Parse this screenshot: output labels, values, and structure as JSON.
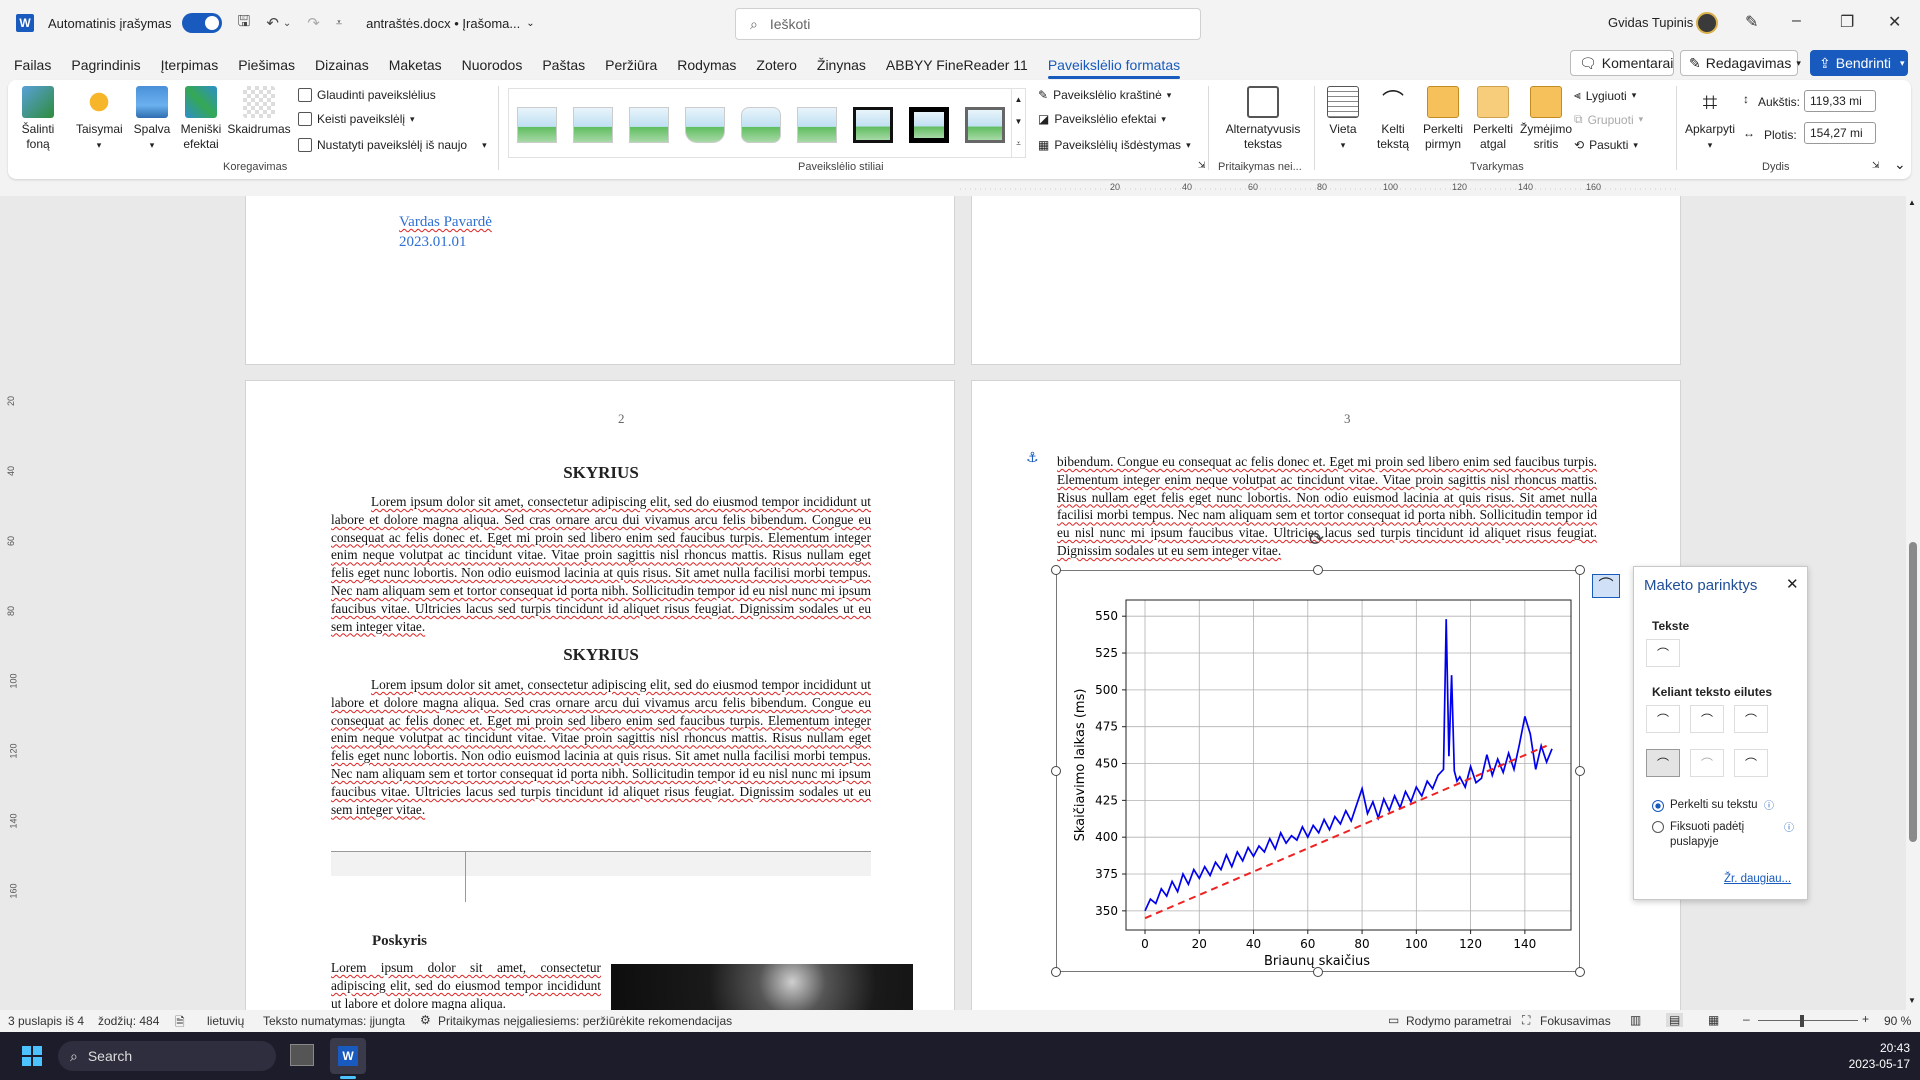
{
  "titlebar": {
    "autosave_label": "Automatinis įrašymas",
    "doc_name": "antraštės.docx • Įrašoma...",
    "search_placeholder": "Ieškoti",
    "user_name": "Gvidas Tupinis"
  },
  "menu": {
    "tabs": [
      "Failas",
      "Pagrindinis",
      "Įterpimas",
      "Piešimas",
      "Dizainas",
      "Maketas",
      "Nuorodos",
      "Paštas",
      "Peržiūra",
      "Rodymas",
      "Zotero",
      "Žinynas",
      "ABBYY FineReader 11",
      "Paveikslėlio formatas"
    ],
    "active_tab": "Paveikslėlio formatas",
    "comments": "Komentarai",
    "editing": "Redagavimas",
    "share": "Bendrinti"
  },
  "ribbon": {
    "remove_bg": "Šalinti foną",
    "corrections": "Taisymai",
    "color": "Spalva",
    "artistic": "Meniški efektai",
    "transparency": "Skaidrumas",
    "compress": "Glaudinti paveikslėlius",
    "change": "Keisti paveikslėlį",
    "reset": "Nustatyti paveikslėlį iš naujo",
    "group_adjust": "Koregavimas",
    "group_styles": "Paveikslėlio stiliai",
    "border": "Paveikslėlio kraštinė",
    "effects": "Paveikslėlio efektai",
    "layout": "Paveikslėlių išdėstymas",
    "alt_text": "Alternatyvusis tekstas",
    "group_access": "Pritaikymas nei...",
    "position": "Vieta",
    "wrap": "Kelti tekstą",
    "forward": "Perkelti pirmyn",
    "backward": "Perkelti atgal",
    "selection": "Žymėjimo sritis",
    "align": "Lygiuoti",
    "group_btn": "Grupuoti",
    "rotate": "Pasukti",
    "group_arrange": "Tvarkymas",
    "crop": "Apkarpyti",
    "height_label": "Aukštis:",
    "height_val": "119,33 mi",
    "width_label": "Plotis:",
    "width_val": "154,27 mi",
    "group_size": "Dydis"
  },
  "ruler_ticks": [
    "20",
    "40",
    "60",
    "80",
    "100",
    "120",
    "140",
    "160"
  ],
  "vruler_ticks": [
    "20",
    "40",
    "60",
    "80",
    "100",
    "120",
    "140",
    "160"
  ],
  "page1": {
    "author": "Vardas Pavardė",
    "date": "2023.01.01"
  },
  "page2": {
    "number": "2",
    "heading1": "SKYRIUS",
    "para1": "Lorem ipsum dolor sit amet, consectetur adipiscing elit, sed do eiusmod tempor incididunt ut labore et dolore magna aliqua. Sed cras ornare arcu dui vivamus arcu felis bibendum. Congue eu consequat ac felis donec et. Eget mi proin sed libero enim sed faucibus turpis. Elementum integer enim neque volutpat ac tincidunt vitae. Vitae proin sagittis nisl rhoncus mattis. Risus nullam eget felis eget nunc lobortis. Non odio euismod lacinia at quis risus. Sit amet nulla facilisi morbi tempus. Nec nam aliquam sem et tortor consequat id porta nibh. Sollicitudin tempor id eu nisl nunc mi ipsum faucibus vitae. Ultricies lacus sed turpis tincidunt id aliquet risus feugiat. Dignissim sodales ut eu sem integer vitae.",
    "heading2": "SKYRIUS",
    "para2": "Lorem ipsum dolor sit amet, consectetur adipiscing elit, sed do eiusmod tempor incididunt ut labore et dolore magna aliqua. Sed cras ornare arcu dui vivamus arcu felis bibendum. Congue eu consequat ac felis donec et. Eget mi proin sed libero enim sed faucibus turpis. Elementum integer enim neque volutpat ac tincidunt vitae. Vitae proin sagittis nisl rhoncus mattis. Risus nullam eget felis eget nunc lobortis. Non odio euismod lacinia at quis risus. Sit amet nulla facilisi morbi tempus. Nec nam aliquam sem et tortor consequat id porta nibh. Sollicitudin tempor id eu nisl nunc mi ipsum faucibus vitae. Ultricies lacus sed turpis tincidunt id aliquet risus feugiat. Dignissim sodales ut eu sem integer vitae.",
    "subheading": "Poskyris",
    "para3": "Lorem ipsum dolor sit amet, consectetur adipiscing elit, sed do eiusmod tempor incididunt ut labore et dolore magna aliqua."
  },
  "page3": {
    "number": "3",
    "para1": "bibendum. Congue eu consequat ac felis donec et. Eget mi proin sed libero enim sed faucibus turpis. Elementum integer enim neque volutpat ac tincidunt vitae. Vitae proin sagittis nisl rhoncus mattis. Risus nullam eget felis eget nunc lobortis. Non odio euismod lacinia at quis risus. Sit amet nulla facilisi morbi tempus. Nec nam aliquam sem et tortor consequat id porta nibh. Sollicitudin tempor id eu nisl nunc mi ipsum faucibus vitae. Ultricies lacus sed turpis tincidunt id aliquet risus feugiat. Dignissim sodales ut eu sem integer vitae."
  },
  "layout_pane": {
    "title": "Maketo parinktys",
    "inline_section": "Tekste",
    "wrap_section": "Keliant teksto eilutes",
    "move_with_text": "Perkelti su tekstu",
    "fix_position": "Fiksuoti padėtį puslapyje",
    "see_more": "Žr. daugiau..."
  },
  "chart_data": {
    "type": "line",
    "xlabel": "Briaunų skaičius",
    "ylabel": "Skaičiavimo laikas (ms)",
    "xlim": [
      -7,
      157
    ],
    "ylim": [
      337,
      561
    ],
    "xticks": [
      0,
      20,
      40,
      60,
      80,
      100,
      120,
      140
    ],
    "yticks": [
      350,
      375,
      400,
      425,
      450,
      475,
      500,
      525,
      550
    ],
    "grid": true,
    "series": [
      {
        "color": "#0000ee",
        "style": "solid",
        "x": [
          0,
          2,
          4,
          6,
          8,
          10,
          12,
          14,
          16,
          18,
          20,
          22,
          24,
          26,
          28,
          30,
          32,
          34,
          36,
          38,
          40,
          42,
          44,
          46,
          48,
          50,
          52,
          54,
          56,
          58,
          60,
          62,
          64,
          66,
          68,
          70,
          72,
          74,
          76,
          78,
          80,
          82,
          84,
          86,
          88,
          90,
          92,
          94,
          96,
          98,
          100,
          102,
          104,
          106,
          108,
          110,
          111,
          112,
          113,
          114,
          115,
          116,
          118,
          120,
          122,
          124,
          126,
          128,
          130,
          132,
          134,
          136,
          138,
          140,
          142,
          143,
          144,
          146,
          148,
          150
        ],
        "y": [
          350,
          358,
          355,
          365,
          360,
          370,
          363,
          375,
          368,
          378,
          372,
          380,
          374,
          383,
          378,
          388,
          380,
          390,
          384,
          393,
          387,
          394,
          390,
          399,
          392,
          403,
          396,
          401,
          398,
          407,
          400,
          408,
          403,
          412,
          405,
          414,
          409,
          418,
          411,
          422,
          433,
          416,
          424,
          413,
          426,
          418,
          428,
          420,
          431,
          424,
          434,
          428,
          438,
          433,
          442,
          446,
          548,
          455,
          510,
          445,
          438,
          441,
          434,
          448,
          437,
          440,
          456,
          442,
          453,
          444,
          457,
          446,
          463,
          482,
          470,
          458,
          446,
          462,
          451,
          460
        ]
      },
      {
        "color": "#ee2222",
        "style": "dashed",
        "x": [
          0,
          148
        ],
        "y": [
          345,
          462
        ]
      }
    ]
  },
  "statusbar": {
    "page_info": "3 puslapis iš 4",
    "words": "žodžių: 484",
    "language": "lietuvių",
    "prediction": "Teksto numatymas: įjungta",
    "accessibility": "Pritaikymas neįgaliesiems: peržiūrėkite rekomendacijas",
    "display_settings": "Rodymo parametrai",
    "focus": "Fokusavimas",
    "zoom": "90 %"
  },
  "taskbar": {
    "search": "Search",
    "time": "20:43",
    "date": "2023-05-17"
  }
}
